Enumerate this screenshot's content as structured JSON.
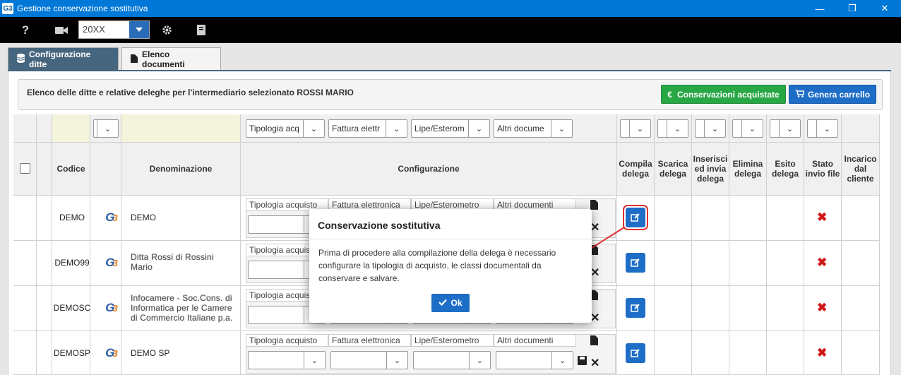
{
  "window": {
    "title": "Gestione conservazione sostitutiva",
    "logo": "G3"
  },
  "toolbar": {
    "help": "?",
    "year": "20XX"
  },
  "tabs": [
    {
      "label": "Configurazione ditte"
    },
    {
      "label": "Elenco documenti"
    }
  ],
  "info": {
    "text": "Elenco delle ditte e relative deleghe per l'intermediario selezionato ROSSI MARIO",
    "btn_acquistate": "Conservazioni acquistate",
    "btn_carrello": "Genera carrello"
  },
  "filters": {
    "tipologia": "Tipologia acq",
    "fattura": "Fattura elettr",
    "lipe": "Lipe/Esterom",
    "altri": "Altri docume"
  },
  "headers": {
    "codice": "Codice",
    "denominazione": "Denominazione",
    "configurazione": "Configurazione",
    "compila": "Compila delega",
    "scarica": "Scarica delega",
    "inserisci": "Inserisci ed invia delega",
    "elimina": "Elimina delega",
    "esito": "Esito delega",
    "stato": "Stato invio file",
    "incarico": "Incarico dal cliente"
  },
  "conf_labels": {
    "tipologia": "Tipologia acquisto",
    "fattura": "Fattura elettronica",
    "lipe": "Lipe/Esterometro",
    "altri": "Altri documenti"
  },
  "rows": [
    {
      "codice": "DEMO",
      "denominazione": "DEMO"
    },
    {
      "codice": "DEMO99",
      "denominazione": "Ditta Rossi di Rossini Mario"
    },
    {
      "codice": "DEMOSC",
      "denominazione": "Infocamere - Soc.Cons. di Informatica per le Camere di Commercio Italiane p.a."
    },
    {
      "codice": "DEMOSP",
      "denominazione": "DEMO SP"
    }
  ],
  "modal": {
    "title": "Conservazione sostitutiva",
    "body": "Prima di procedere alla compilazione della delega è necessario configurare la tipologia di acquisto, le classi documentali da conservare e salvare.",
    "ok": "Ok"
  },
  "colors": {
    "titlebar": "#0078d7",
    "accent": "#1e6ec8",
    "green": "#28a745",
    "tab_active": "#46657e",
    "error": "#d01818"
  }
}
